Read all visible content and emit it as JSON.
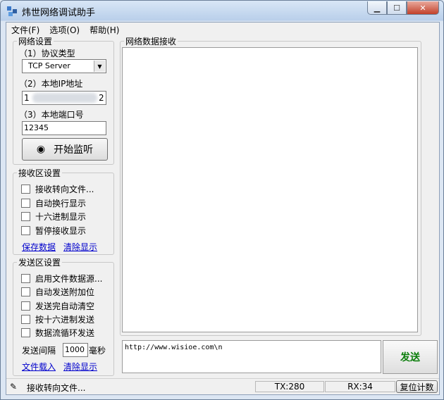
{
  "window": {
    "title": "炜世网络调试助手"
  },
  "menu": [
    "文件(F)",
    "选项(O)",
    "帮助(H)"
  ],
  "network": {
    "legend": "网络设置",
    "protocol_label": "（1）协议类型",
    "protocol_value": "TCP Server",
    "ip_label": "（2）本地IP地址",
    "ip_first": "1",
    "ip_last": "2",
    "port_label": "（3）本地端口号",
    "port_value": "12345",
    "listen_button": "开始监听"
  },
  "receive": {
    "legend": "接收区设置",
    "options": [
      "接收转向文件...",
      "自动换行显示",
      "十六进制显示",
      "暂停接收显示"
    ],
    "save_link": "保存数据",
    "clear_link": "清除显示"
  },
  "send": {
    "legend": "发送区设置",
    "options": [
      "启用文件数据源...",
      "自动发送附加位",
      "发送完自动清空",
      "按十六进制发送",
      "数据流循环发送"
    ],
    "interval_label": "发送间隔",
    "interval_value": "1000",
    "interval_unit": "毫秒",
    "load_link": "文件载入",
    "clear_link": "清除显示"
  },
  "recv_panel": {
    "legend": "网络数据接收"
  },
  "send_input": {
    "value": "http://www.wisioe.com\\n"
  },
  "send_button": "发送",
  "status": {
    "message": "接收转向文件...",
    "tx": "TX:280",
    "rx": "RX:34",
    "reset": "复位计数"
  }
}
